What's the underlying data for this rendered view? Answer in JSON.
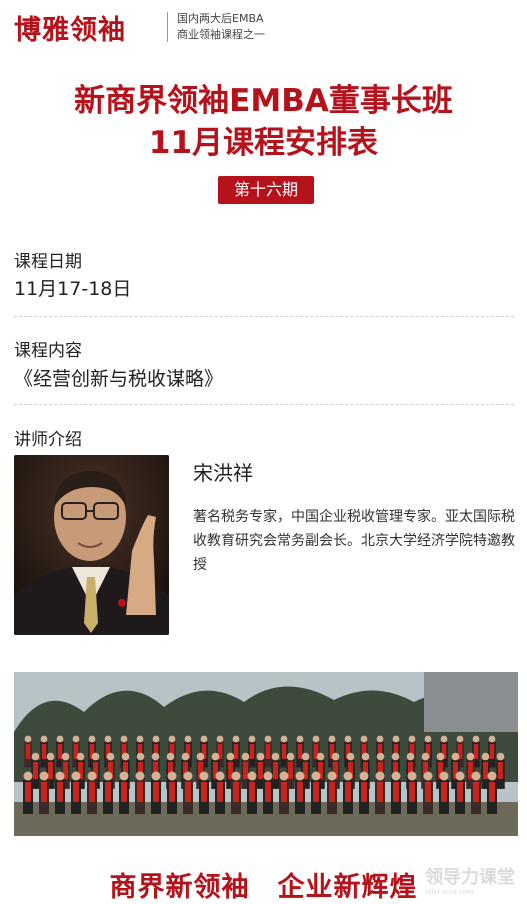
{
  "header": {
    "logo": "博雅领袖",
    "tagline_line1": "国内两大后EMBA",
    "tagline_line2": "商业领袖课程之一"
  },
  "title": {
    "line1": "新商界领袖EMBA董事长班",
    "line2": "11月课程安排表"
  },
  "badge": "第十六期",
  "sections": {
    "date": {
      "label": "课程日期",
      "value": "11月17-18日"
    },
    "content": {
      "label": "课程内容",
      "value": "《经营创新与税收谋略》"
    },
    "lecturer": {
      "label": "讲师介绍",
      "name": "宋洪祥",
      "bio": "著名税务专家，中国企业税收管理专家。亚太国际税收教育研究会常务副会长。北京大学经济学院特邀教授"
    }
  },
  "slogan": "商界新领袖　企业新辉煌",
  "watermark": {
    "main": "领导力课堂",
    "sub": "ldlkt.sina.com"
  },
  "colors": {
    "brand_red": "#b5121b"
  }
}
